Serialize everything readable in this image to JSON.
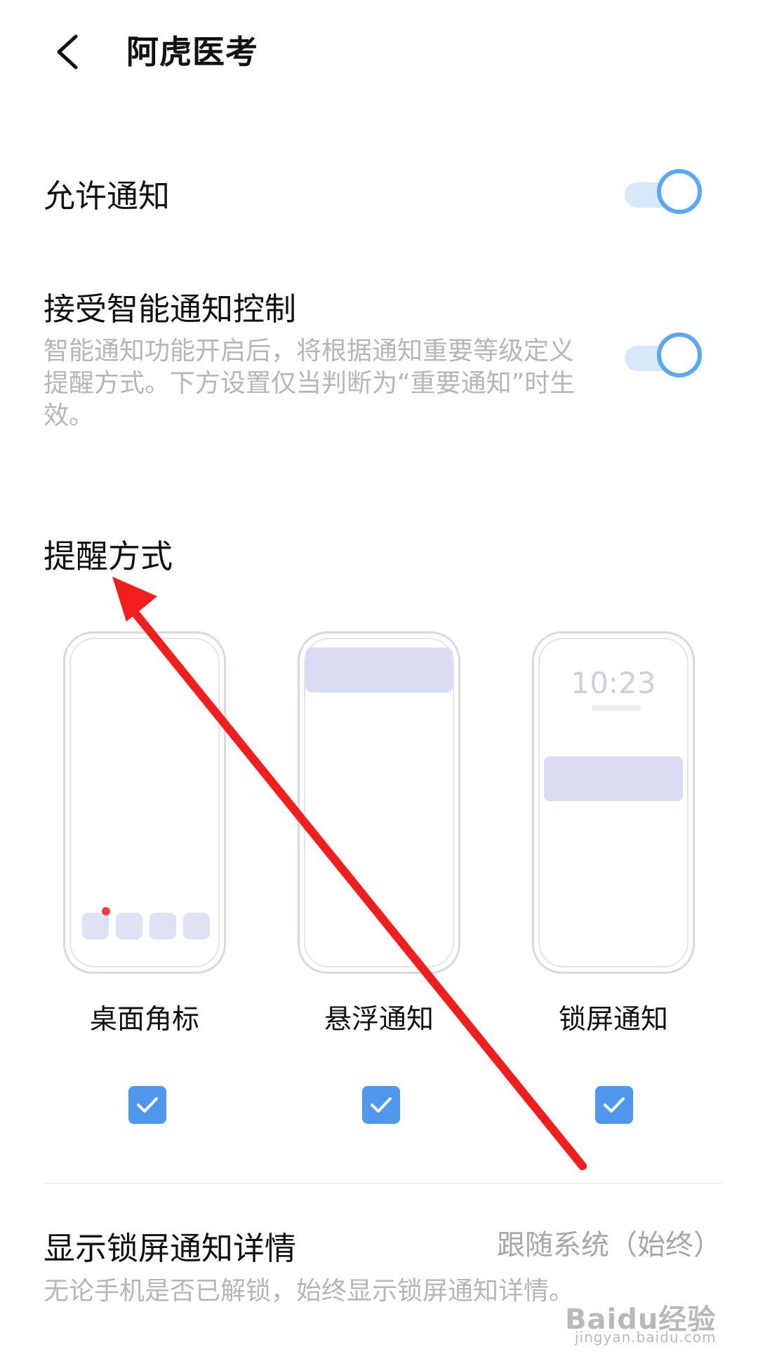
{
  "header": {
    "title": "阿虎医考",
    "back_icon": "chevron-left-icon"
  },
  "settings": {
    "allow_notifications": {
      "label": "允许通知",
      "enabled": true
    },
    "smart_control": {
      "label": "接受智能通知控制",
      "description": "智能通知功能开启后，将根据通知重要等级定义提醒方式。下方设置仅当判断为“重要通知”时生效。",
      "enabled": true
    }
  },
  "reminder": {
    "section_title": "提醒方式",
    "options": [
      {
        "label": "桌面角标",
        "checked": true
      },
      {
        "label": "悬浮通知",
        "checked": true
      },
      {
        "label": "锁屏通知",
        "checked": true,
        "clock": "10:23"
      }
    ]
  },
  "lockscreen_details": {
    "label": "显示锁屏通知详情",
    "value": "跟随系统（始终）",
    "description": "无论手机是否已解锁，始终显示锁屏通知详情。"
  },
  "watermark": {
    "logo": "Baidu经验",
    "url": "jingyan.baidu.com"
  },
  "colors": {
    "accent": "#4f98ed",
    "toggle_track": "#d7e8fb",
    "phone_block": "#d9dcf2",
    "badge_dot": "#ef3b4a",
    "arrow": "#f21d1d"
  }
}
